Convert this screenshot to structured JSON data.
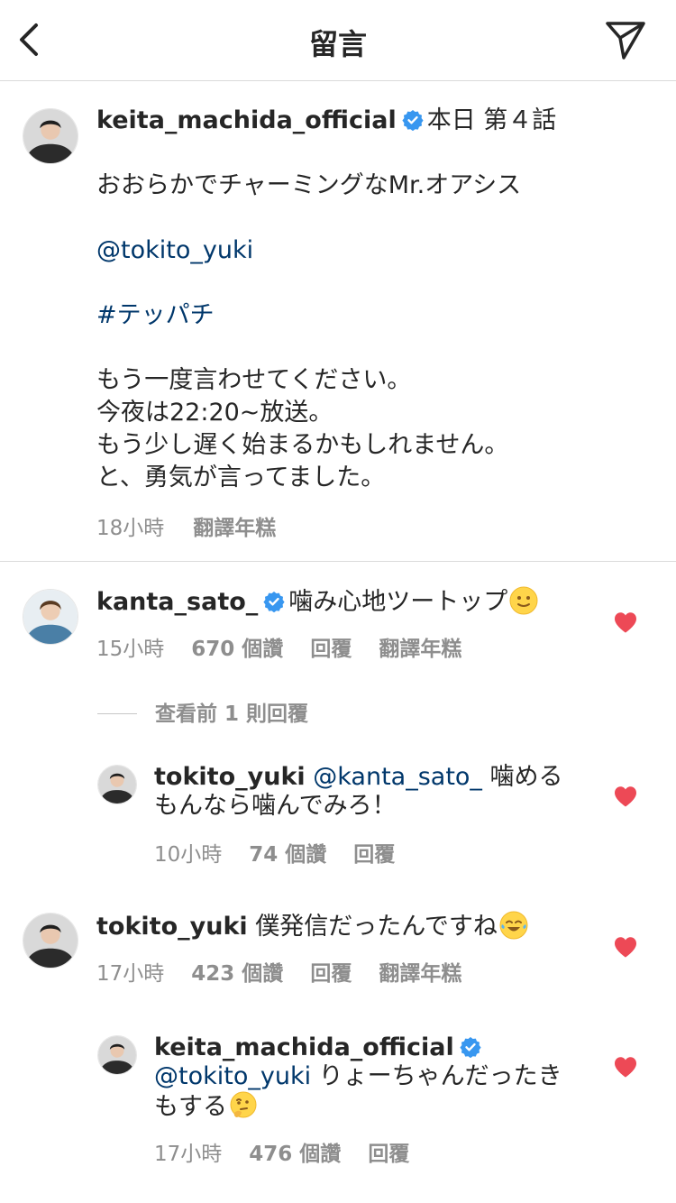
{
  "header": {
    "title": "留言"
  },
  "caption": {
    "username": "keita_machida_official",
    "title_line": "本日 第４話",
    "line1": "おおらかでチャーミングなMr.オアシス",
    "mention": "@tokito_yuki",
    "hashtag": "#テッパチ",
    "line2": "もう一度言わせてください。",
    "line3": "今夜は22:20~放送。",
    "line4": "もう少し遅く始まるかもしれません。",
    "line5": "と、勇気が言ってました。",
    "time": "18小時",
    "translate": "翻譯年糕"
  },
  "comments": [
    {
      "username": "kanta_sato_",
      "text": "噛み心地ツートップ",
      "emoji": "slightly-smiling-face",
      "time": "15小時",
      "likes": "670 個讚",
      "reply": "回覆",
      "translate": "翻譯年糕"
    },
    {
      "username": "tokito_yuki",
      "text": "僕発信だったんですね",
      "emoji": "tears-of-joy",
      "time": "17小時",
      "likes": "423 個讚",
      "reply": "回覆",
      "translate": "翻譯年糕"
    }
  ],
  "view_replies": "查看前 1 則回覆",
  "replies": [
    {
      "username": "tokito_yuki",
      "mention": "@kanta_sato_",
      "text": "噛めるもんなら噛んでみろ！",
      "time": "10小時",
      "likes": "74 個讚",
      "reply": "回覆"
    },
    {
      "username": "keita_machida_official",
      "mention": "@tokito_yuki",
      "text": "りょーちゃんだったきもする",
      "emoji": "thinking-face",
      "time": "17小時",
      "likes": "476 個讚",
      "reply": "回覆"
    }
  ],
  "colors": {
    "link": "#00376b",
    "verified": "#3897f0",
    "heart": "#ed4956",
    "meta": "#8e8e8e"
  }
}
